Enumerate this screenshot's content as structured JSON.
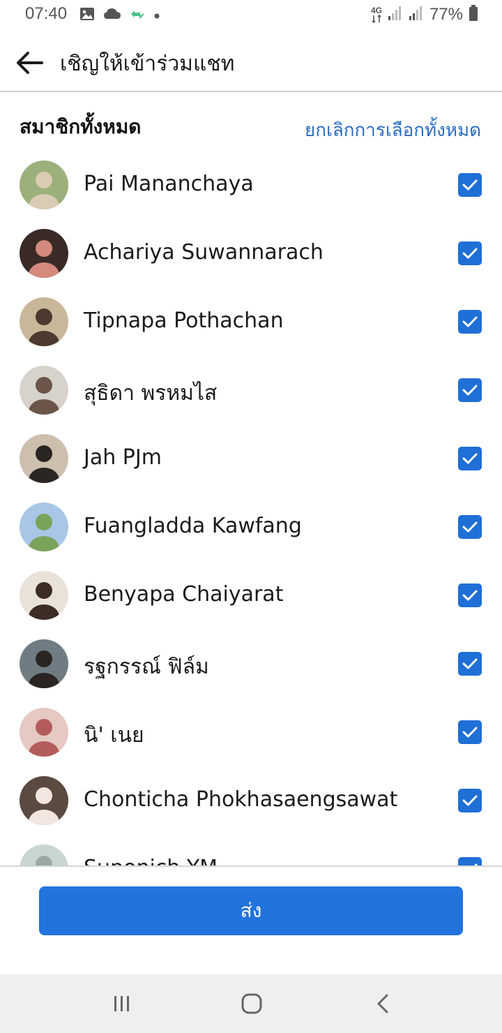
{
  "status_bar": {
    "time": "07:40",
    "network": "4G",
    "battery": "77%",
    "icons": [
      "image-icon",
      "cloud-icon",
      "sync-icon",
      "dot-icon",
      "signal-icon",
      "battery-icon"
    ]
  },
  "header": {
    "title": "เชิญให้เข้าร่วมแชท",
    "back_icon": "back-arrow-icon"
  },
  "section": {
    "title": "สมาชิกทั้งหมด",
    "deselect_all": "ยกเลิกการเลือกทั้งหมด"
  },
  "members": [
    {
      "name": "Pai Mananchaya",
      "checked": true
    },
    {
      "name": "Achariya Suwannarach",
      "checked": true
    },
    {
      "name": "Tipnapa Pothachan",
      "checked": true
    },
    {
      "name": "สุธิดา พรหมไส",
      "checked": true
    },
    {
      "name": "Jah PJm",
      "checked": true
    },
    {
      "name": "Fuangladda Kawfang",
      "checked": true
    },
    {
      "name": "Benyapa Chaiyarat",
      "checked": true
    },
    {
      "name": "รฐกรรณ์ ฟิล์ม",
      "checked": true
    },
    {
      "name": "นิ' เนย",
      "checked": true
    },
    {
      "name": "Chonticha Phokhasaengsawat",
      "checked": true
    },
    {
      "name": "Suponich YM",
      "checked": true
    }
  ],
  "send_button": {
    "label": "ส่ง"
  },
  "colors": {
    "accent": "#2273dc",
    "link": "#2b6cc4",
    "checkbox": "#1f6fd6",
    "nav_bg": "#efefef"
  },
  "nav": {
    "icons": [
      "recent-apps-icon",
      "home-icon",
      "back-icon"
    ]
  }
}
